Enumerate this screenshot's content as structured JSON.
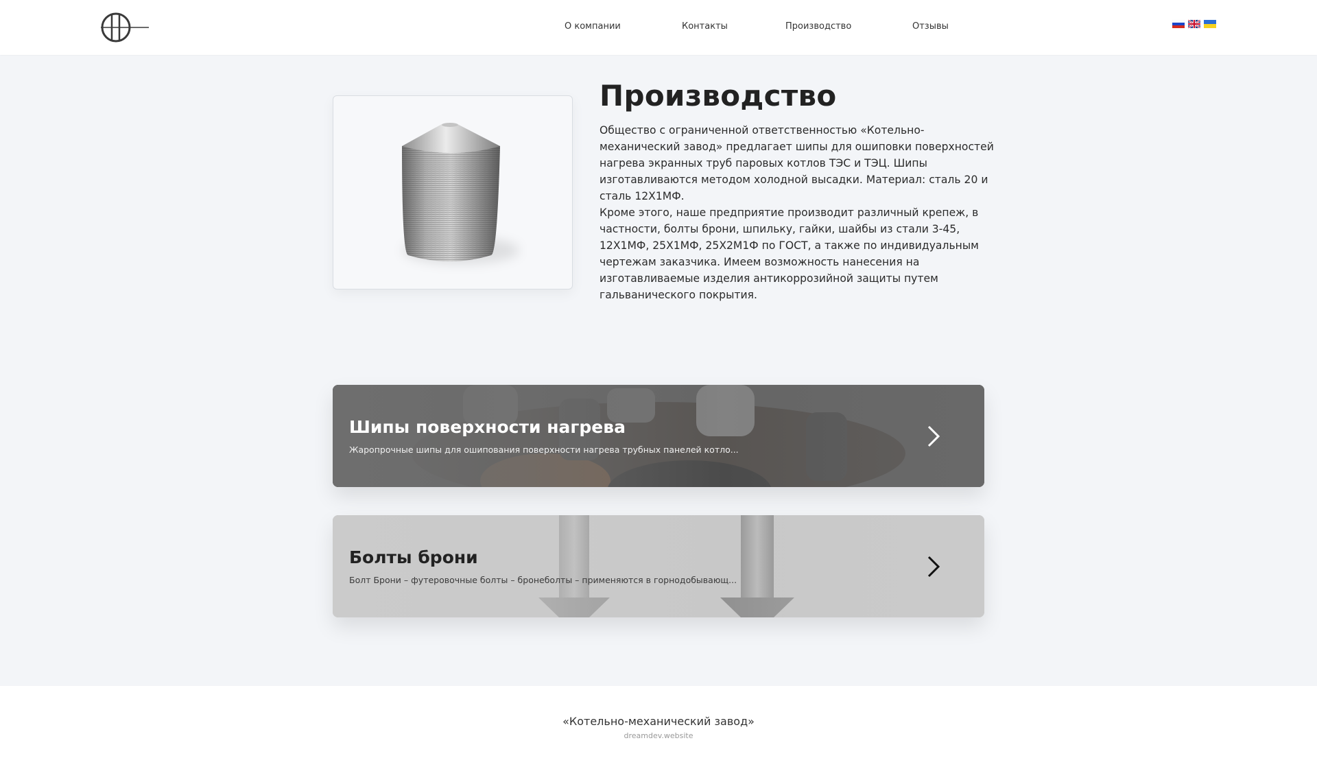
{
  "header": {
    "nav": [
      {
        "label": "О компании"
      },
      {
        "label": "Контакты"
      },
      {
        "label": "Производство"
      },
      {
        "label": "Отзывы"
      }
    ],
    "languages": [
      "ru-flag-icon",
      "uk-flag-icon",
      "ua-flag-icon"
    ]
  },
  "main": {
    "title": "Производство",
    "paragraphs": [
      "Общество с ограниченной ответственностью «Котельно-механический завод» предлагает шипы для ошиповки поверхностей нагрева экранных труб паровых котлов ТЭС и ТЭЦ. Шипы изготавливаются методом холодной высадки. Материал: сталь 20 и сталь 12Х1МФ.",
      "Кроме этого, наше предприятие производит различный крепеж, в частности, болты брони, шпильку, гайки, шайбы из стали 3-45, 12Х1МФ, 25Х1МФ, 25Х2М1Ф по ГОСТ, а также по индивидуальным чертежам заказчика. Имеем возможность нанесения на изготавливаемые изделия антикоррозийной защиты путем гальванического покрытия."
    ]
  },
  "cards": [
    {
      "title": "Шипы поверхности нагрева",
      "subtitle": "Жаропрочные шипы для ошипования поверхности нагрева трубных панелей котло..."
    },
    {
      "title": "Болты брони",
      "subtitle": "Болт Брони – футеровочные болты – бронеболты – применяются в горнодобывающ..."
    }
  ],
  "footer": {
    "company": "«Котельно-механический завод»",
    "site": "dreamdev.website"
  }
}
